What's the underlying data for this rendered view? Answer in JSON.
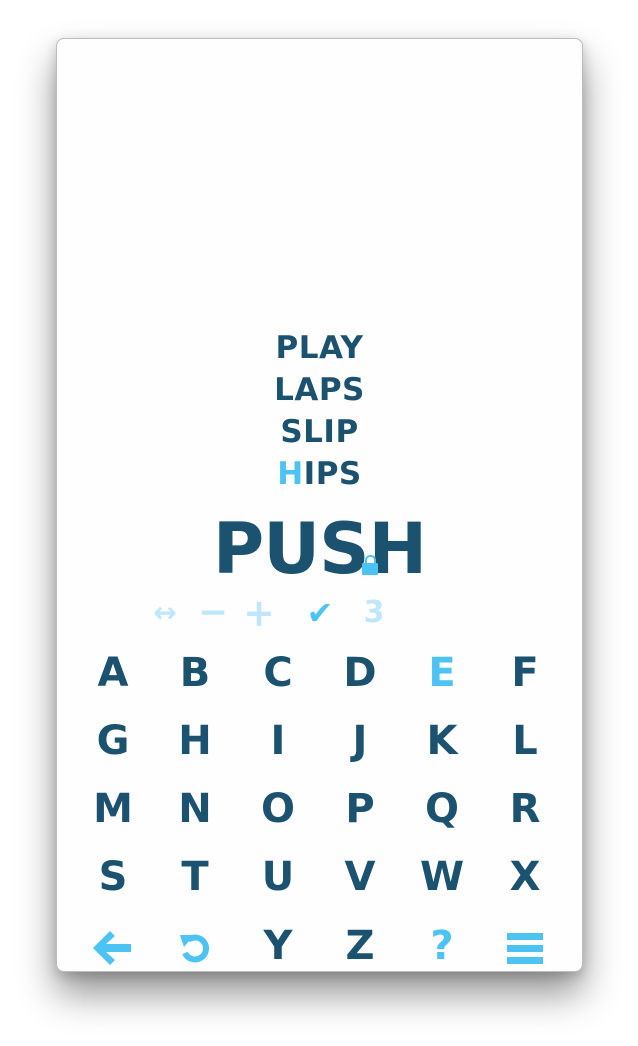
{
  "history": [
    {
      "prefix": "",
      "highlight": "",
      "rest": "PLAY"
    },
    {
      "prefix": "",
      "highlight": "",
      "rest": "LAPS"
    },
    {
      "prefix": "",
      "highlight": "",
      "rest": "SLIP"
    },
    {
      "prefix": "",
      "highlight": "H",
      "rest": "IPS"
    }
  ],
  "current_word": {
    "main": "PUS",
    "locked_letter": "H"
  },
  "toolbar": {
    "swap_icon": "↔",
    "remove_icon": "−",
    "add_icon": "+",
    "submit_icon": "✔",
    "count": "3"
  },
  "keyboard": {
    "rows": [
      [
        "A",
        "B",
        "C",
        "D",
        "E",
        "F"
      ],
      [
        "G",
        "H",
        "I",
        "J",
        "K",
        "L"
      ],
      [
        "M",
        "N",
        "O",
        "P",
        "Q",
        "R"
      ],
      [
        "S",
        "T",
        "U",
        "V",
        "W",
        "X"
      ]
    ],
    "highlighted_key": "E",
    "bottom": {
      "back_icon": "🡸",
      "undo_icon": "↺",
      "y": "Y",
      "z": "Z",
      "help_icon": "?"
    }
  },
  "colors": {
    "primary": "#1a5270",
    "accent": "#4dc3f4",
    "faded": "#bfe6fa"
  }
}
